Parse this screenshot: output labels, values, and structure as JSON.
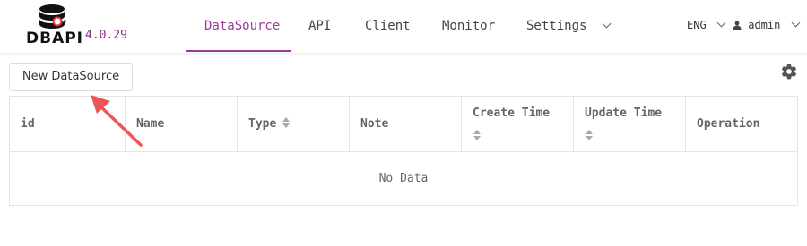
{
  "app": {
    "logo_text": "DBAPI",
    "version": "4.0.29"
  },
  "nav": {
    "items": [
      {
        "label": "DataSource",
        "active": true
      },
      {
        "label": "API",
        "active": false
      },
      {
        "label": "Client",
        "active": false
      },
      {
        "label": "Monitor",
        "active": false
      },
      {
        "label": "Settings",
        "active": false,
        "dropdown": true
      }
    ]
  },
  "header_right": {
    "language": "ENG",
    "user": "admin"
  },
  "toolbar": {
    "new_button_label": "New DataSource",
    "settings_icon": "gear-icon"
  },
  "table": {
    "columns": [
      {
        "label": "id",
        "sortable": false
      },
      {
        "label": "Name",
        "sortable": false
      },
      {
        "label": "Type",
        "sortable": true
      },
      {
        "label": "Note",
        "sortable": false
      },
      {
        "label": "Create Time",
        "sortable": true
      },
      {
        "label": "Update Time",
        "sortable": true
      },
      {
        "label": "Operation",
        "sortable": false
      }
    ],
    "empty_text": "No Data"
  },
  "colors": {
    "accent": "#9b3a9b",
    "version": "#8e2b8e",
    "annotation_arrow": "#f05555"
  }
}
